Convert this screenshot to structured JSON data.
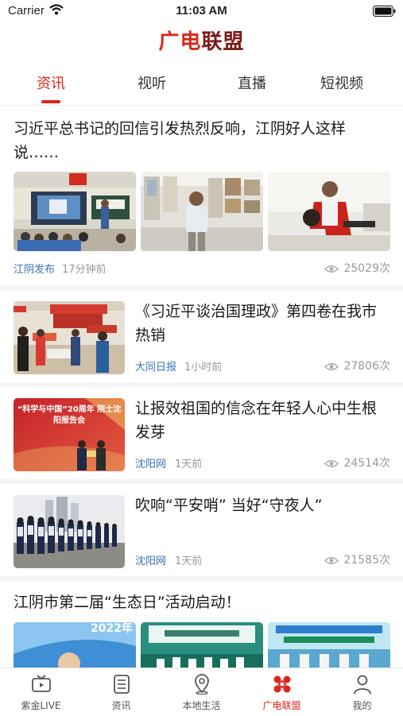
{
  "status": {
    "carrier": "Carrier",
    "time": "11:03 AM"
  },
  "header": {
    "brand_red": "广电",
    "brand_dark": "联盟"
  },
  "tabs": [
    {
      "label": "资讯"
    },
    {
      "label": "视听"
    },
    {
      "label": "直播"
    },
    {
      "label": "短视频"
    }
  ],
  "articles": [
    {
      "title": "习近平总书记的回信引发热烈反响，江阴好人这样说……",
      "source": "江阴发布",
      "time": "17分钟前",
      "views": "25029次"
    },
    {
      "title": "《习近平谈治国理政》第四卷在我市热销",
      "source": "大同日报",
      "time": "1小时前",
      "views": "27806次"
    },
    {
      "title": "让报效祖国的信念在年轻人心中生根发芽",
      "source": "沈阳网",
      "time": "1天前",
      "views": "24514次",
      "thumb_text": "“科学与中国”20周年 院士沈阳报告会"
    },
    {
      "title": "吹响“平安哨” 当好“守夜人”",
      "source": "沈阳网",
      "time": "1天前",
      "views": "21585次"
    },
    {
      "title": "江阴市第二届“生态日”活动启动！",
      "thumb_text": "2022年"
    }
  ],
  "bottom_nav": [
    {
      "label": "紫金LIVE",
      "icon": "tv-icon"
    },
    {
      "label": "资讯",
      "icon": "news-icon"
    },
    {
      "label": "本地生活",
      "icon": "location-icon"
    },
    {
      "label": "广电联盟",
      "icon": "alliance-icon"
    },
    {
      "label": "我的",
      "icon": "profile-icon"
    }
  ],
  "colors": {
    "accent": "#d9261c",
    "source_link": "#3a72b5"
  }
}
